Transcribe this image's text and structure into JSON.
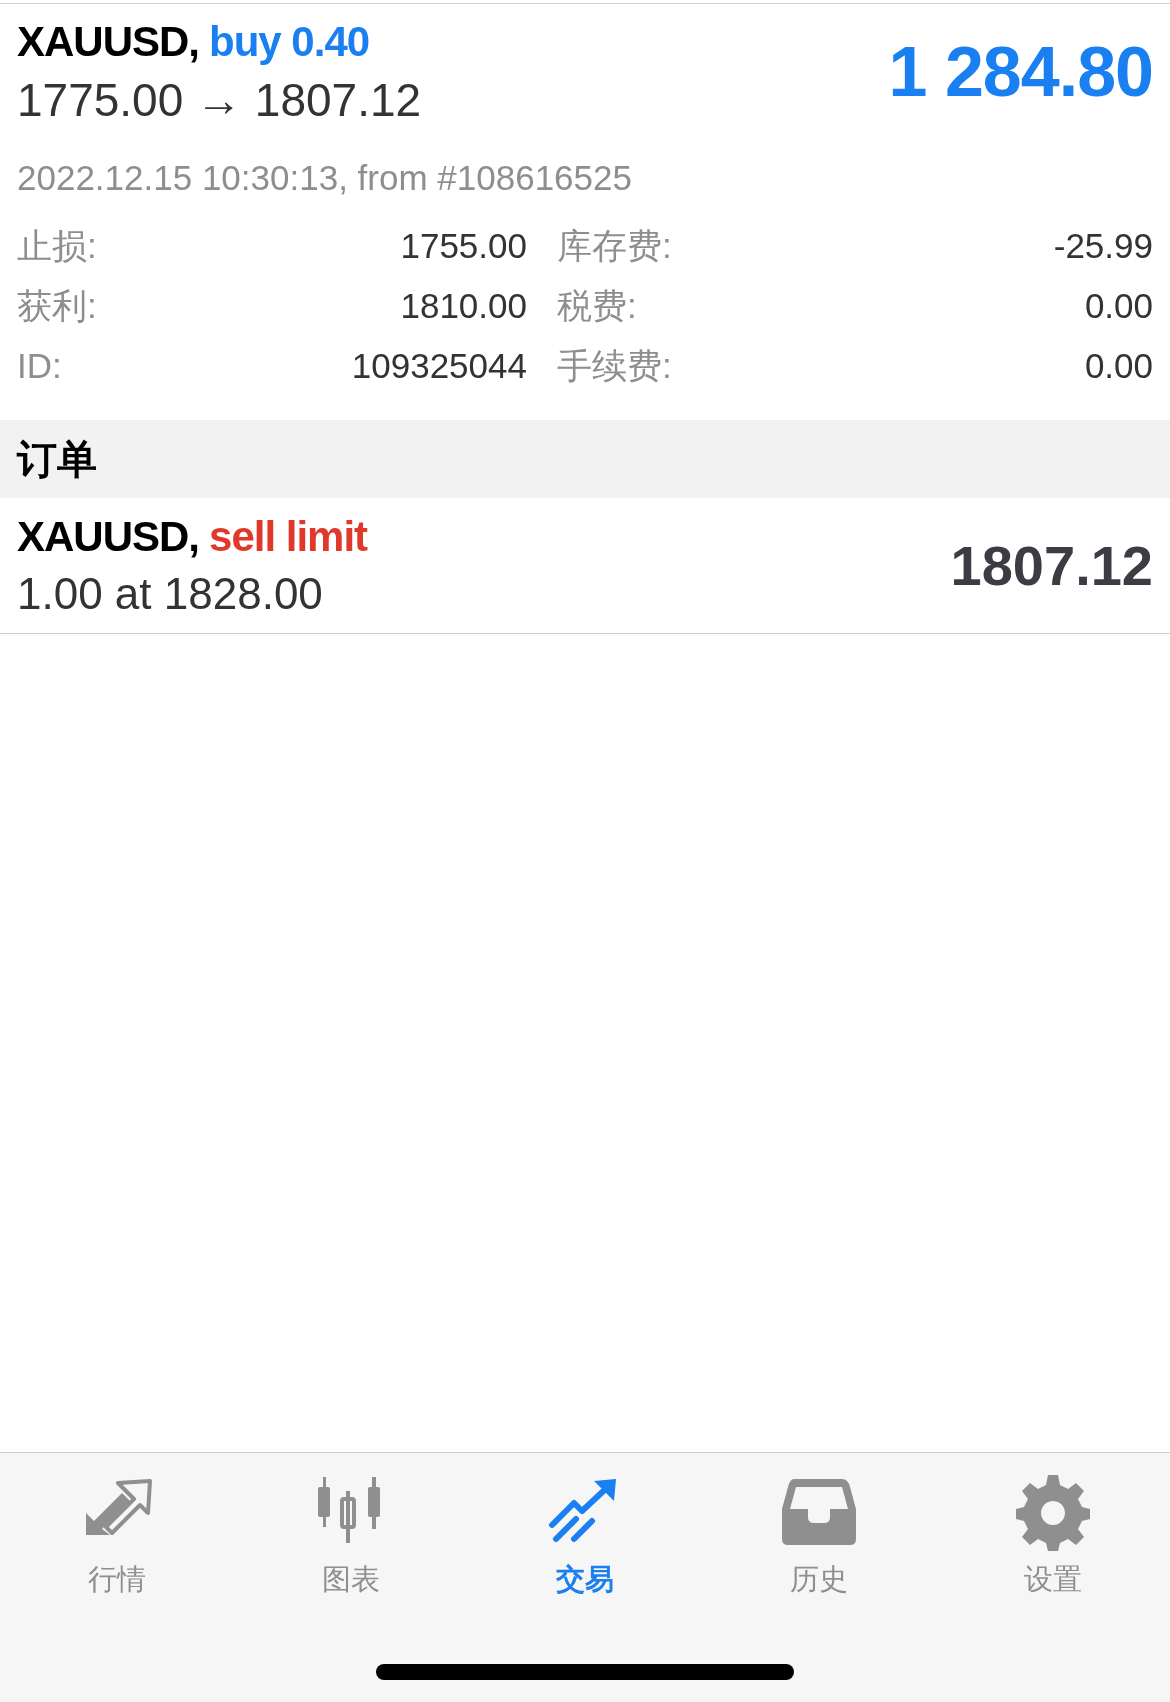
{
  "position": {
    "symbol": "XAUUSD,",
    "side": "buy 0.40",
    "kind": "buy",
    "prices": "1775.00 → 1807.12",
    "profit": "1 284.80",
    "opened": "2022.12.15 10:30:13, from #108616525",
    "details": [
      {
        "label": "止损:",
        "value": "1755.00",
        "label2": "库存费:",
        "value2": "-25.99"
      },
      {
        "label": "获利:",
        "value": "1810.00",
        "label2": "税费:",
        "value2": "0.00"
      },
      {
        "label": "ID:",
        "value": "109325044",
        "label2": "手续费:",
        "value2": "0.00"
      }
    ]
  },
  "orders_header": "订单",
  "orders": [
    {
      "symbol": "XAUUSD,",
      "side": "sell limit",
      "kind": "sell",
      "detail": "1.00 at 1828.00",
      "price": "1807.12"
    }
  ],
  "tab_bar": [
    {
      "label": "行情",
      "kind": "quotes",
      "selected": false
    },
    {
      "label": "图表",
      "kind": "chart",
      "selected": false
    },
    {
      "label": "交易",
      "kind": "trade",
      "selected": true
    },
    {
      "label": "历史",
      "kind": "history",
      "selected": false
    },
    {
      "label": "设置",
      "kind": "settings",
      "selected": false
    }
  ]
}
